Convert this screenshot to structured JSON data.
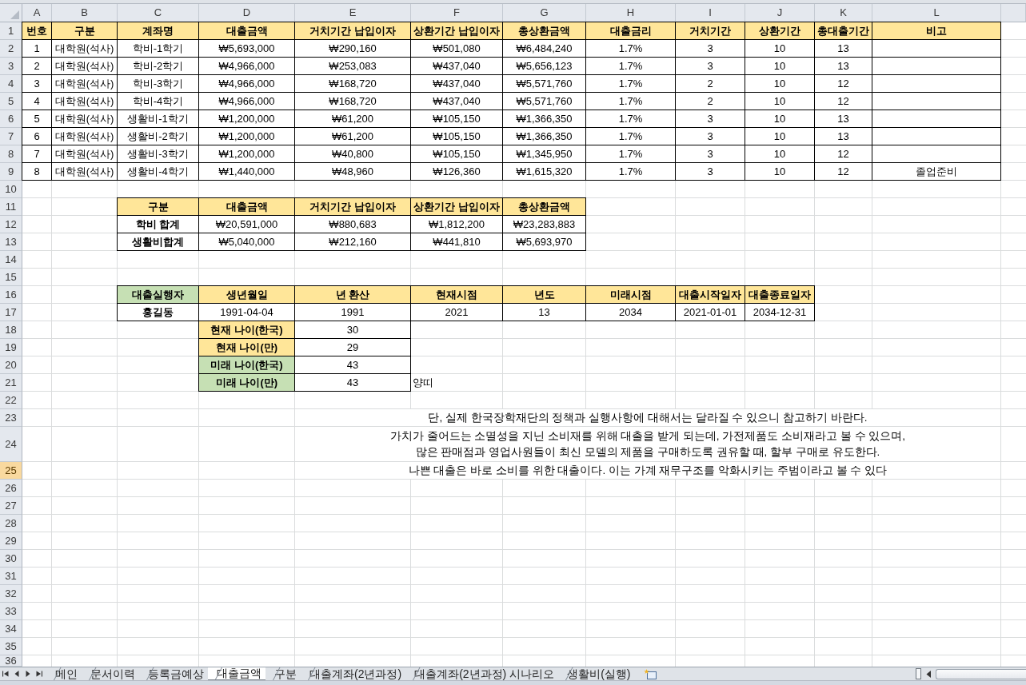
{
  "column_headers": [
    "A",
    "B",
    "C",
    "D",
    "E",
    "F",
    "G",
    "H",
    "I",
    "J",
    "K",
    "L"
  ],
  "row_headers": [
    {
      "label": "1",
      "selected": false
    },
    {
      "label": "2",
      "selected": false
    },
    {
      "label": "3",
      "selected": false
    },
    {
      "label": "4",
      "selected": false
    },
    {
      "label": "5",
      "selected": false
    },
    {
      "label": "6",
      "selected": false
    },
    {
      "label": "7",
      "selected": false
    },
    {
      "label": "8",
      "selected": false
    },
    {
      "label": "9",
      "selected": false
    },
    {
      "label": "10",
      "selected": false
    },
    {
      "label": "11",
      "selected": false
    },
    {
      "label": "12",
      "selected": false
    },
    {
      "label": "13",
      "selected": false
    },
    {
      "label": "14",
      "selected": false
    },
    {
      "label": "15",
      "selected": false
    },
    {
      "label": "16",
      "selected": false
    },
    {
      "label": "17",
      "selected": false
    },
    {
      "label": "18",
      "selected": false
    },
    {
      "label": "19",
      "selected": false
    },
    {
      "label": "20",
      "selected": false
    },
    {
      "label": "21",
      "selected": false
    },
    {
      "label": "22",
      "selected": false
    },
    {
      "label": "23",
      "selected": false
    },
    {
      "label": "24",
      "selected": false
    },
    {
      "label": "25",
      "selected": true
    },
    {
      "label": "26",
      "selected": false
    },
    {
      "label": "27",
      "selected": false
    },
    {
      "label": "28",
      "selected": false
    },
    {
      "label": "29",
      "selected": false
    },
    {
      "label": "30",
      "selected": false
    },
    {
      "label": "31",
      "selected": false
    },
    {
      "label": "32",
      "selected": false
    },
    {
      "label": "33",
      "selected": false
    },
    {
      "label": "34",
      "selected": false
    },
    {
      "label": "35",
      "selected": false
    },
    {
      "label": "36",
      "selected": false
    }
  ],
  "loan_table": {
    "columns": [
      "번호",
      "구분",
      "계좌명",
      "대출금액",
      "거치기간 납입이자",
      "상환기간 납입이자",
      "총상환금액",
      "대출금리",
      "거치기간",
      "상환기간",
      "총대출기간",
      "비고"
    ],
    "rows": [
      {
        "values": [
          "1",
          "대학원(석사)",
          "학비-1학기",
          "₩5,693,000",
          "₩290,160",
          "₩501,080",
          "₩6,484,240",
          "1.7%",
          "3",
          "10",
          "13"
        ]
      },
      {
        "values": [
          "2",
          "대학원(석사)",
          "학비-2학기",
          "₩4,966,000",
          "₩253,083",
          "₩437,040",
          "₩5,656,123",
          "1.7%",
          "3",
          "10",
          "13"
        ]
      },
      {
        "values": [
          "3",
          "대학원(석사)",
          "학비-3학기",
          "₩4,966,000",
          "₩168,720",
          "₩437,040",
          "₩5,571,760",
          "1.7%",
          "2",
          "10",
          "12"
        ]
      },
      {
        "values": [
          "4",
          "대학원(석사)",
          "학비-4학기",
          "₩4,966,000",
          "₩168,720",
          "₩437,040",
          "₩5,571,760",
          "1.7%",
          "2",
          "10",
          "12"
        ]
      },
      {
        "values": [
          "5",
          "대학원(석사)",
          "생활비-1학기",
          "₩1,200,000",
          "₩61,200",
          "₩105,150",
          "₩1,366,350",
          "1.7%",
          "3",
          "10",
          "13"
        ]
      },
      {
        "values": [
          "6",
          "대학원(석사)",
          "생활비-2학기",
          "₩1,200,000",
          "₩61,200",
          "₩105,150",
          "₩1,366,350",
          "1.7%",
          "3",
          "10",
          "13"
        ]
      },
      {
        "values": [
          "7",
          "대학원(석사)",
          "생활비-3학기",
          "₩1,200,000",
          "₩40,800",
          "₩105,150",
          "₩1,345,950",
          "1.7%",
          "3",
          "10",
          "12"
        ]
      },
      {
        "values": [
          "8",
          "대학원(석사)",
          "생활비-4학기",
          "₩1,440,000",
          "₩48,960",
          "₩126,360",
          "₩1,615,320",
          "1.7%",
          "3",
          "10",
          "12"
        ],
        "remark": "졸업준비"
      }
    ]
  },
  "summary_table": {
    "columns": [
      "구분",
      "대출금액",
      "거치기간 납입이자",
      "상환기간 납입이자",
      "총상환금액"
    ],
    "rows": [
      {
        "label": "학비 합계",
        "values": [
          "₩20,591,000",
          "₩880,683",
          "₩1,812,200",
          "₩23,283,883"
        ]
      },
      {
        "label": "생활비합계",
        "values": [
          "₩5,040,000",
          "₩212,160",
          "₩441,810",
          "₩5,693,970"
        ]
      }
    ]
  },
  "borrower_table": {
    "columns": [
      {
        "label": "대출실행자",
        "color": "#c6e0b4"
      },
      {
        "label": "생년월일",
        "color": "#ffe699"
      },
      {
        "label": "년 환산",
        "color": "#ffe699"
      },
      {
        "label": "현재시점",
        "color": "#ffe699"
      },
      {
        "label": "년도",
        "color": "#ffe699"
      },
      {
        "label": "미래시점",
        "color": "#ffe699"
      },
      {
        "label": "대출시작일자",
        "color": "#ffe699"
      },
      {
        "label": "대출종료일자",
        "color": "#ffe699"
      }
    ],
    "values": [
      "홍길동",
      "1991-04-04",
      "1991",
      "2021",
      "13",
      "2034",
      "2021-01-01",
      "2034-12-31"
    ]
  },
  "age_table": [
    {
      "label": "현재 나이(한국)",
      "color": "#ffe699",
      "value": "30"
    },
    {
      "label": "현재 나이(만)",
      "color": "#ffe699",
      "value": "29"
    },
    {
      "label": "미래 나이(한국)",
      "color": "#c6e0b4",
      "value": "43"
    },
    {
      "label": "미래 나이(만)",
      "color": "#c6e0b4",
      "value": "43"
    }
  ],
  "side_note": "양띠",
  "notes": [
    "단, 실제 한국장학재단의 정책과 실행사항에 대해서는 달라질 수 있으니 참고하기 바란다.",
    "가치가 줄어드는 소멸성을 지닌 소비재를 위해 대출을 받게 되는데, 가전제품도 소비재라고 볼 수 있으며,\n많은 판매점과 영업사원들이 최신 모델의 제품을 구매하도록 권유할 때, 할부 구매로 유도한다.",
    "나쁜 대출은 바로 소비를 위한 대출이다. 이는 가계 재무구조를 악화시키는 주범이라고 볼 수 있다"
  ],
  "sheet_tabs": [
    {
      "label": "메인",
      "selected": false
    },
    {
      "label": "문서이력",
      "selected": false
    },
    {
      "label": "등록금예상",
      "selected": false
    },
    {
      "label": "대출금액",
      "selected": true
    },
    {
      "label": "구분",
      "selected": false
    },
    {
      "label": "대출계좌(2년과정)",
      "selected": false
    },
    {
      "label": "대출계좌(2년과정) 시나리오",
      "selected": false
    },
    {
      "label": "생활비(실행)",
      "selected": false
    }
  ]
}
